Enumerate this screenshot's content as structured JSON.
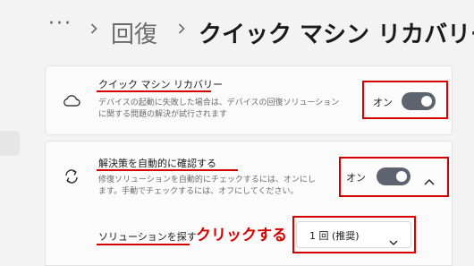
{
  "breadcrumb": {
    "more_label": "···",
    "parent": "回復",
    "current": "クイック マシン リカバリー"
  },
  "quick_recovery": {
    "title": "クイック マシン リカバリー",
    "description_line1": "デバイスの起動に失敗した場合は、デバイスの回復ソリューション",
    "description_line2": "に関する問題の解決が試行されます",
    "toggle_label": "オン",
    "toggle_on": true,
    "icon": "cloud-icon"
  },
  "auto_check": {
    "title": "解決策を自動的に確認する",
    "description_line1": "修復ソリューションを自動的にチェックするには、オンにし",
    "description_line2": "ます。手動でチェックするには、オフにしてください。",
    "toggle_label": "オン",
    "toggle_on": true,
    "icon": "sync-arrows-icon"
  },
  "find_solution": {
    "label": "ソリューションを探す",
    "annotation": "クリックする",
    "interval_value": "1 回 (推奨)"
  },
  "colors": {
    "annotation_red": "#d40000",
    "toggle_on": "#5d6470",
    "card_bg": "#fbfbfb",
    "page_bg": "#f3f3f3"
  }
}
